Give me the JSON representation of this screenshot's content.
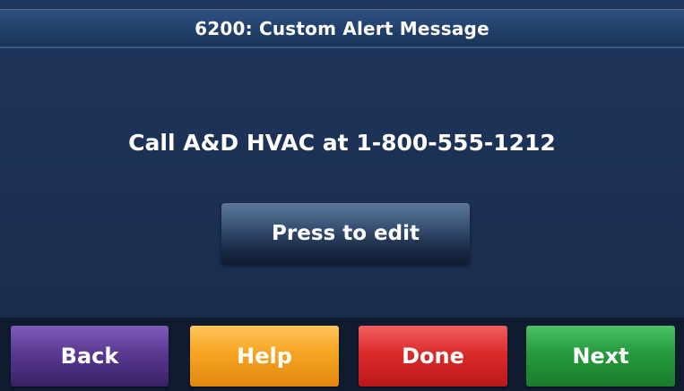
{
  "header": {
    "title": "6200: Custom Alert Message"
  },
  "main": {
    "message": "Call A&D HVAC at 1-800-555-1212",
    "edit_button_label": "Press to edit"
  },
  "footer": {
    "back_label": "Back",
    "help_label": "Help",
    "done_label": "Done",
    "next_label": "Next"
  },
  "colors": {
    "background": "#1c3154",
    "back_button": "#5a3a92",
    "help_button": "#f7a423",
    "done_button": "#dc2b2b",
    "next_button": "#259a3c"
  }
}
